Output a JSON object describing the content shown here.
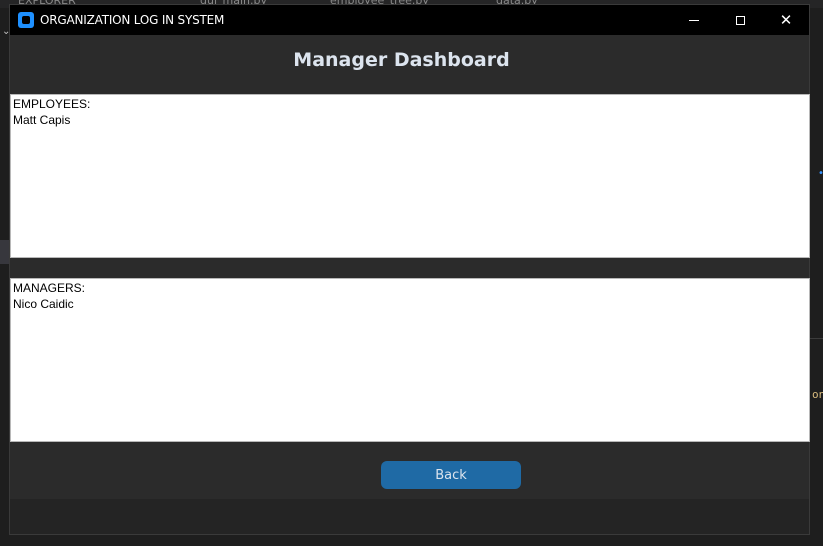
{
  "background": {
    "tabs": [
      "EXPLORER",
      "gui_main.py",
      "employee_tree.py",
      "data.py"
    ],
    "right_fragment": "on"
  },
  "window": {
    "title": "ORGANIZATION LOG IN SYSTEM",
    "controls": {
      "minimize": "minimize",
      "maximize": "maximize",
      "close": "✕"
    }
  },
  "page": {
    "title": "Manager Dashboard"
  },
  "employees_box": {
    "header": "EMPLOYEES:",
    "items": [
      "Matt Capis"
    ]
  },
  "managers_box": {
    "header": "MANAGERS:",
    "items": [
      "Nico Caidic"
    ]
  },
  "actions": {
    "back_label": "Back"
  },
  "colors": {
    "titlebar": "#000000",
    "window_bg": "#2b2b2b",
    "accent_button": "#1f6aa5",
    "title_text": "#dce4ee",
    "textbox_bg": "#ffffff"
  },
  "icons": {
    "app": "app-icon",
    "close": "close-icon",
    "minimize": "minimize-icon",
    "maximize": "maximize-icon"
  }
}
